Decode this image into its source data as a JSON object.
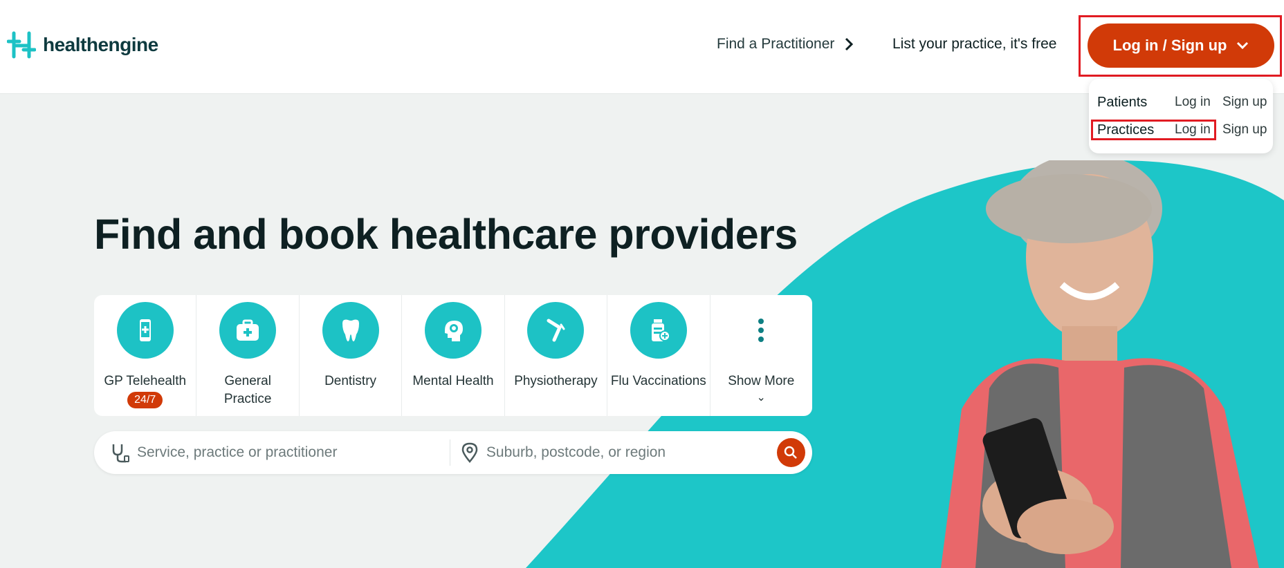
{
  "header": {
    "logo_text": "healthengine",
    "nav_find": "Find a Practitioner",
    "nav_list": "List your practice, it's free",
    "login_button": "Log in / Sign up"
  },
  "dropdown": {
    "rows": [
      {
        "group": "Patients",
        "login": "Log in",
        "signup": "Sign up"
      },
      {
        "group": "Practices",
        "login": "Log in",
        "signup": "Sign up"
      }
    ]
  },
  "hero": {
    "title": "Find and book healthcare providers"
  },
  "categories": [
    {
      "label": "GP Telehealth",
      "badge": "24/7",
      "icon": "phone-plus-icon"
    },
    {
      "label": "General Practice",
      "icon": "medical-bag-icon"
    },
    {
      "label": "Dentistry",
      "icon": "tooth-icon"
    },
    {
      "label": "Mental Health",
      "icon": "head-brain-icon"
    },
    {
      "label": "Physiotherapy",
      "icon": "knee-joint-icon"
    },
    {
      "label": "Flu Vaccinations",
      "icon": "vaccine-bottle-icon"
    },
    {
      "label": "Show More",
      "icon": "more-dots-icon"
    }
  ],
  "search": {
    "service_placeholder": "Service, practice or practitioner",
    "location_placeholder": "Suburb, postcode, or region"
  },
  "colors": {
    "brand_orange": "#d13a08",
    "teal": "#1dc2c5",
    "highlight_red": "#e11b22"
  }
}
